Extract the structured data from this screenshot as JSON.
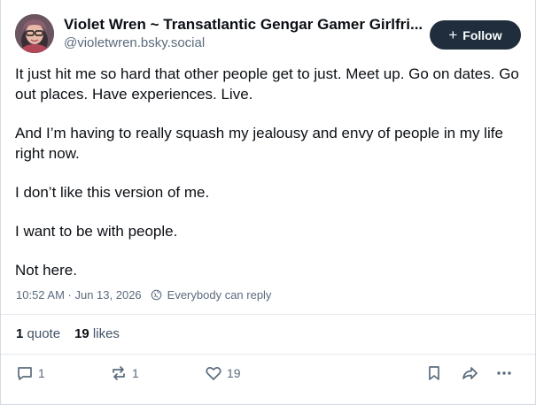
{
  "author": {
    "display_name": "Violet Wren ~ Transatlantic Gengar Gamer Girlfri...",
    "handle": "@violetwren.bsky.social",
    "avatar_icon": "user-avatar-photo"
  },
  "follow_button": {
    "label": "Follow",
    "icon": "plus-icon"
  },
  "post": {
    "paragraphs": [
      "It just hit me so hard that other people get to just. Meet up. Go on dates. Go out places. Have experiences. Live.",
      "And I’m having to really squash my jealousy and envy of people in my life right now.",
      "I don’t like this version of me.",
      "I want to be with people.",
      "Not here."
    ]
  },
  "meta": {
    "timestamp": "10:52 AM · Jun 13, 2026",
    "reply_setting": "Everybody can reply"
  },
  "stats": {
    "quote_count": "1",
    "quote_label": "quote",
    "like_count": "19",
    "like_label": "likes"
  },
  "actions": {
    "reply_count": "1",
    "repost_count": "1",
    "like_count": "19"
  },
  "colors": {
    "follow_bg": "#1f2d3d",
    "muted_text": "#5b6b7d",
    "border": "#d4dbe2"
  }
}
